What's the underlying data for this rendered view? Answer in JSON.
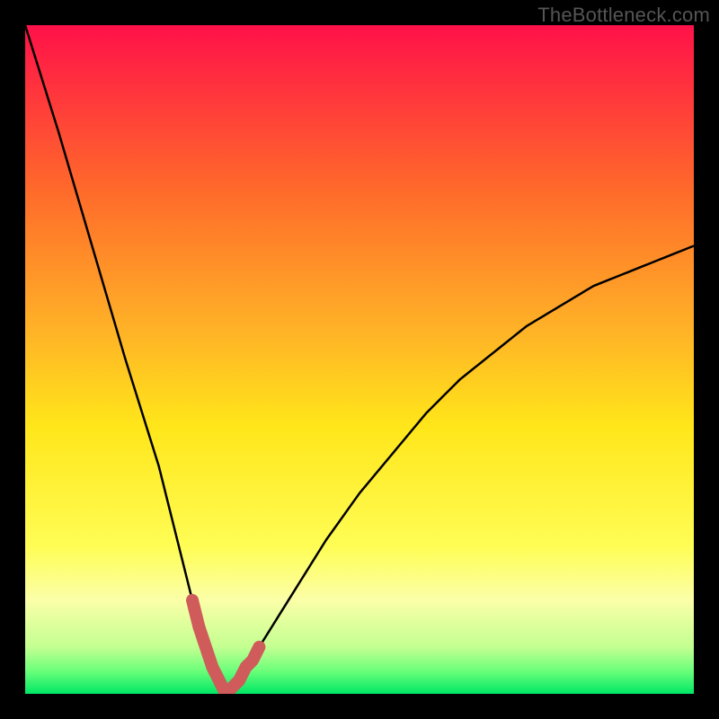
{
  "watermark": "TheBottleneck.com",
  "chart_data": {
    "type": "line",
    "title": "",
    "xlabel": "",
    "ylabel": "",
    "xlim": [
      0,
      100
    ],
    "ylim": [
      0,
      100
    ],
    "grid": false,
    "series": [
      {
        "name": "curve",
        "x": [
          0,
          5,
          10,
          15,
          20,
          23,
          25,
          27,
          29,
          30,
          32,
          35,
          40,
          45,
          50,
          55,
          60,
          65,
          70,
          75,
          80,
          85,
          90,
          95,
          100
        ],
        "y": [
          100,
          84,
          67,
          50,
          34,
          22,
          14,
          7,
          2,
          0,
          2,
          7,
          15,
          23,
          30,
          36,
          42,
          47,
          51,
          55,
          58,
          61,
          63,
          65,
          67
        ]
      },
      {
        "name": "highlight",
        "x": [
          25,
          26,
          27,
          28,
          29,
          30,
          31,
          32,
          33,
          34,
          35
        ],
        "y": [
          14,
          10,
          7,
          4,
          2,
          0,
          1,
          2,
          4,
          5,
          7
        ]
      }
    ],
    "gradient_stops": [
      {
        "offset": 0,
        "color": "#ff1149"
      },
      {
        "offset": 0.25,
        "color": "#ff6b2a"
      },
      {
        "offset": 0.45,
        "color": "#ffb027"
      },
      {
        "offset": 0.6,
        "color": "#ffe61a"
      },
      {
        "offset": 0.78,
        "color": "#fffd55"
      },
      {
        "offset": 0.86,
        "color": "#fbffa8"
      },
      {
        "offset": 0.93,
        "color": "#c3ff91"
      },
      {
        "offset": 0.965,
        "color": "#6dff7a"
      },
      {
        "offset": 1.0,
        "color": "#00e765"
      }
    ],
    "colors": {
      "curve_stroke": "#000000",
      "highlight_stroke": "#cf5b5b",
      "background_frame": "#000000"
    }
  }
}
